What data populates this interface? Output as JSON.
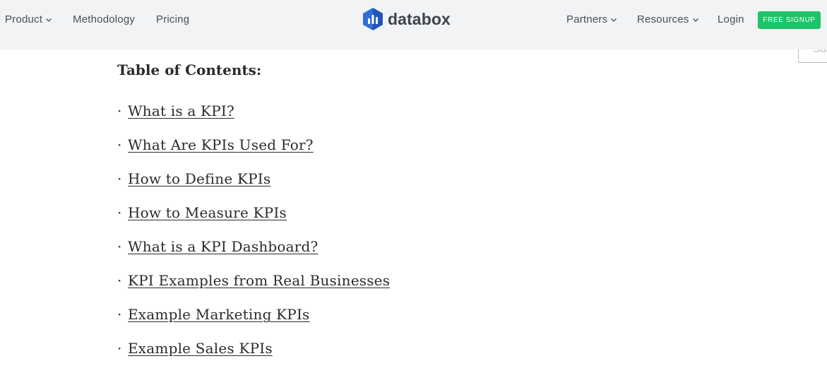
{
  "nav": {
    "left_items": [
      {
        "label": "Product",
        "has_dropdown": true
      },
      {
        "label": "Methodology",
        "has_dropdown": false
      },
      {
        "label": "Pricing",
        "has_dropdown": false
      }
    ],
    "logo_text": "databox",
    "right_items": [
      {
        "label": "Partners",
        "has_dropdown": true
      },
      {
        "label": "Resources",
        "has_dropdown": true
      },
      {
        "label": "Login",
        "has_dropdown": false
      }
    ],
    "signup_label": "FREE SIGNUP"
  },
  "search": {
    "visible_text": "Sub"
  },
  "toc": {
    "title": "Table of Contents:",
    "bullet": "·",
    "items": [
      "What is a KPI?",
      "What Are KPIs Used For?",
      "How to Define KPIs",
      "How to Measure KPIs",
      "What is a KPI Dashboard?",
      "KPI Examples from Real Businesses",
      "Example Marketing KPIs",
      "Example Sales KPIs"
    ]
  },
  "colors": {
    "navbar_bg": "#f2f3f4",
    "nav_text": "#4a4f57",
    "signup_bg": "#1bc469",
    "logo_blue": "#2f6fd6",
    "text": "#2b2b2b"
  },
  "icons": {
    "dropdown": "chevron-down-icon",
    "logo": "databox-logo-icon"
  }
}
